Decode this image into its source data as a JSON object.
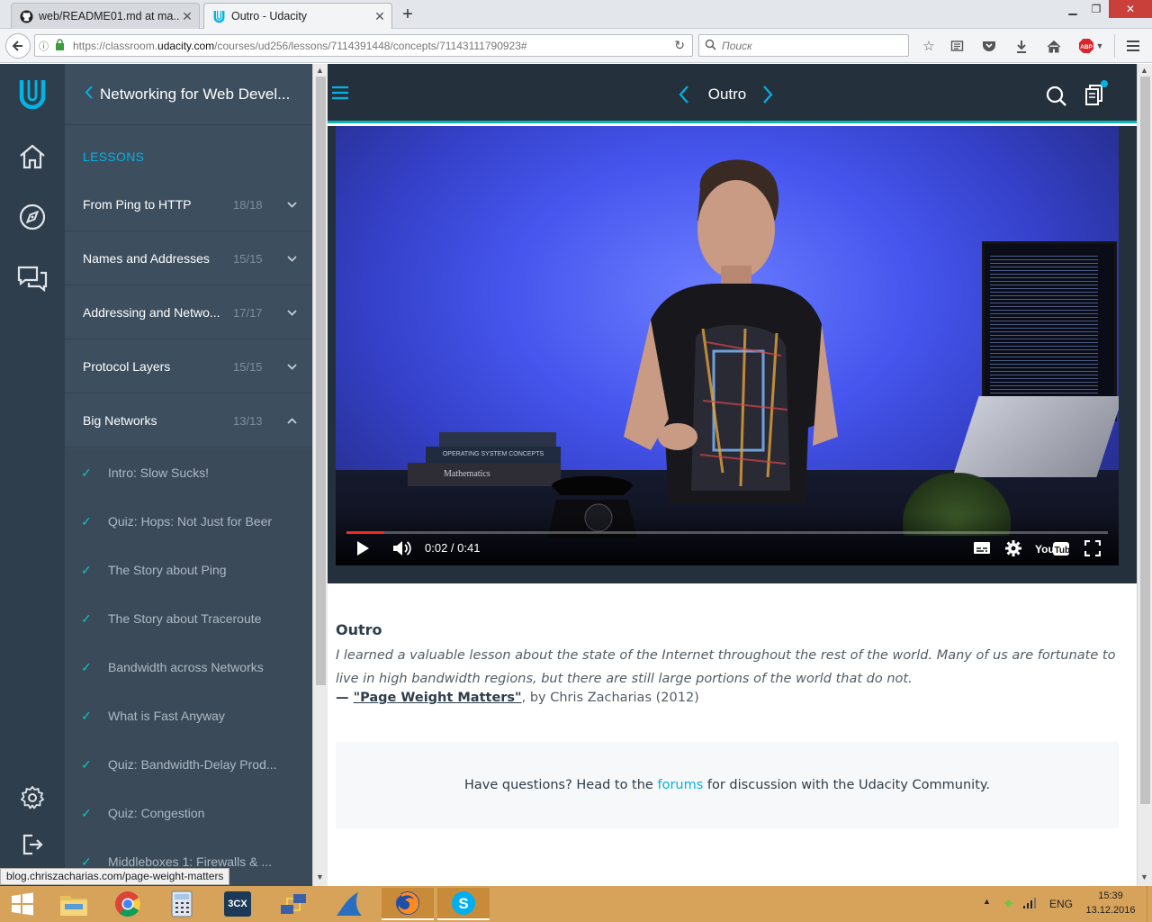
{
  "browser": {
    "tabs": [
      {
        "title": "web/README01.md at ma...",
        "icon": "github-icon",
        "active": false
      },
      {
        "title": "Outro - Udacity",
        "icon": "udacity-icon",
        "active": true
      }
    ],
    "new_tab_glyph": "+",
    "url_prefix": "https://classroom.",
    "url_domain": "udacity.com",
    "url_path": "/courses/ud256/lessons/7114391448/concepts/71143111790923#",
    "search_placeholder": "Поиск",
    "abp_label": "ABP"
  },
  "rail": {
    "icons": [
      "udacity-logo-icon",
      "home-icon",
      "compass-icon",
      "chat-icon",
      "settings-icon",
      "logout-icon"
    ]
  },
  "sidebar": {
    "course_title": "Networking for Web Devel...",
    "lessons_heading": "LESSONS",
    "lessons": [
      {
        "title": "From Ping to HTTP",
        "count": "18/18",
        "expanded": false
      },
      {
        "title": "Names and Addresses",
        "count": "15/15",
        "expanded": false
      },
      {
        "title": "Addressing and Netwo...",
        "count": "17/17",
        "expanded": false
      },
      {
        "title": "Protocol Layers",
        "count": "15/15",
        "expanded": false
      },
      {
        "title": "Big Networks",
        "count": "13/13",
        "expanded": true
      }
    ],
    "concepts": [
      "Intro: Slow Sucks!",
      "Quiz: Hops: Not Just for Beer",
      "The Story about Ping",
      "The Story about Traceroute",
      "Bandwidth across Networks",
      "What is Fast Anyway",
      "Quiz: Bandwidth-Delay Prod...",
      "Quiz: Congestion",
      "Middleboxes 1: Firewalls & ..."
    ]
  },
  "header": {
    "title": "Outro"
  },
  "video": {
    "time": "0:02 / 0:41",
    "progress": 0.05,
    "book_spine_1": "OPERATING SYSTEM CONCEPTS",
    "book_spine_2": "Mathematics"
  },
  "content": {
    "heading": "Outro",
    "quote": "I learned a valuable lesson about the state of the Internet throughout the rest of the world. Many of us are fortunate to live in high bandwidth regions, but there are still large portions of the world that do not.",
    "attribution_dash": "— ",
    "attribution_link": "\"Page Weight Matters\"",
    "attribution_rest": ", by Chris Zacharias (2012)",
    "forum_before": "Have questions? Head to the ",
    "forum_link": "forums",
    "forum_after": " for discussion with the Udacity Community."
  },
  "status_url": "blog.chriszacharias.com/page-weight-matters",
  "taskbar": {
    "lang": "ENG",
    "time": "15:39",
    "date": "13.12.2016",
    "app_3cx": "3CX"
  },
  "colors": {
    "accent": "#02b3e4",
    "teal": "#0fb3b4",
    "check": "#0dc5c1"
  }
}
